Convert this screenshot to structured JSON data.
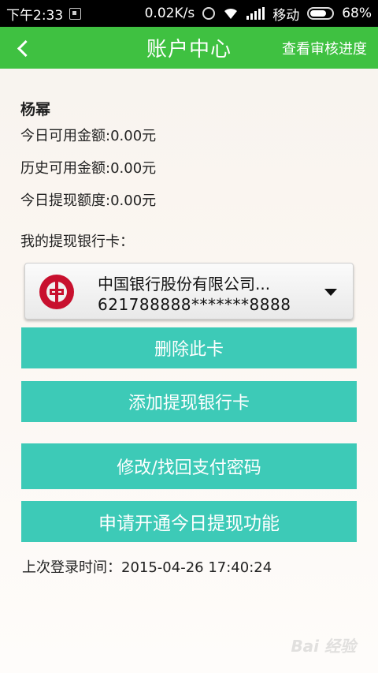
{
  "status_bar": {
    "time": "下午2:33",
    "speed": "0.02K/s",
    "carrier": "移动",
    "battery": "68%"
  },
  "header": {
    "title": "账户中心",
    "progress_link": "查看审核进度"
  },
  "account": {
    "name": "杨幂",
    "today_available": "今日可用金额:0.00元",
    "history_available": "历史可用金额:0.00元",
    "today_quota": "今日提现额度:0.00元",
    "card_label": "我的提现银行卡："
  },
  "card": {
    "bank_name": "中国银行股份有限公司...",
    "number": "621788888*******8888"
  },
  "buttons": {
    "delete": "删除此卡",
    "add": "添加提现银行卡",
    "password": "修改/找回支付密码",
    "apply": "申请开通今日提现功能"
  },
  "last_login": "上次登录时间：2015-04-26 17:40:24",
  "watermark": "Bai 经验",
  "colors": {
    "header_green": "#3fc141",
    "button_teal": "#3dcab7",
    "bank_red": "#c8102e"
  }
}
